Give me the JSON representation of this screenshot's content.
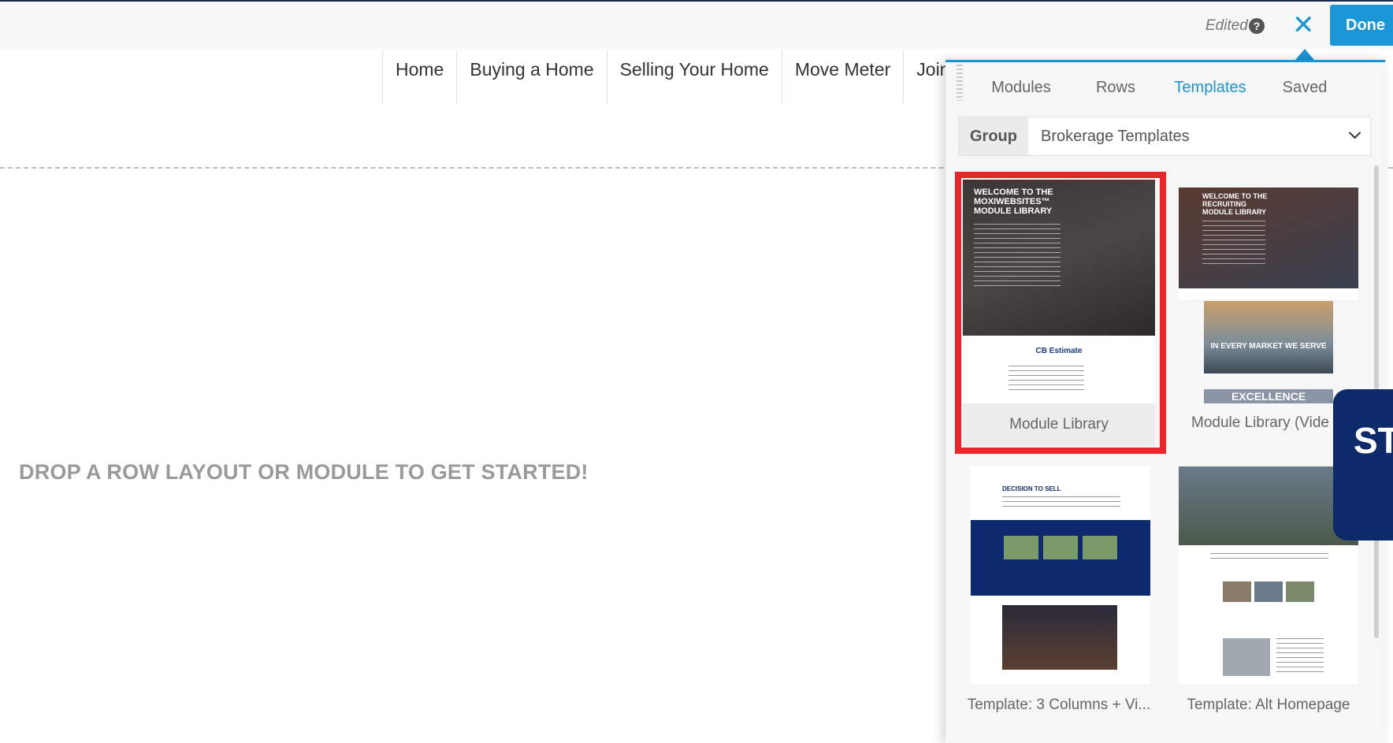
{
  "toolbar": {
    "edited_label": "Edited",
    "done_label": "Done"
  },
  "nav": {
    "items": [
      "Home",
      "Buying a Home",
      "Selling Your Home",
      "Move Meter",
      "Join"
    ]
  },
  "canvas": {
    "drop_text": "DROP A ROW LAYOUT OR MODULE TO GET STARTED!"
  },
  "panel": {
    "tabs": [
      "Modules",
      "Rows",
      "Templates",
      "Saved"
    ],
    "active_tab": "Templates",
    "group_label": "Group",
    "group_value": "Brokerage Templates",
    "templates": [
      {
        "label": "Module Library",
        "thumb_title": "WELCOME TO THE MOXIWEBSITES™ MODULE LIBRARY",
        "thumb_caption": "CB Estimate"
      },
      {
        "label": "Module Library (Vide",
        "thumb_title": "WELCOME TO THE RECRUITING MODULE LIBRARY",
        "thumb_caption": "IN EVERY MARKET WE SERVE",
        "thumb_banner": "EXCELLENCE"
      },
      {
        "label": "Template: 3 Columns + Vi...",
        "thumb_title": "DECISION TO SELL"
      },
      {
        "label": "Template: Alt Homepage"
      }
    ]
  },
  "callout": {
    "text": "ST"
  },
  "colors": {
    "accent": "#1a95d6",
    "highlight": "#e8262a",
    "navy": "#0d2b6b"
  }
}
